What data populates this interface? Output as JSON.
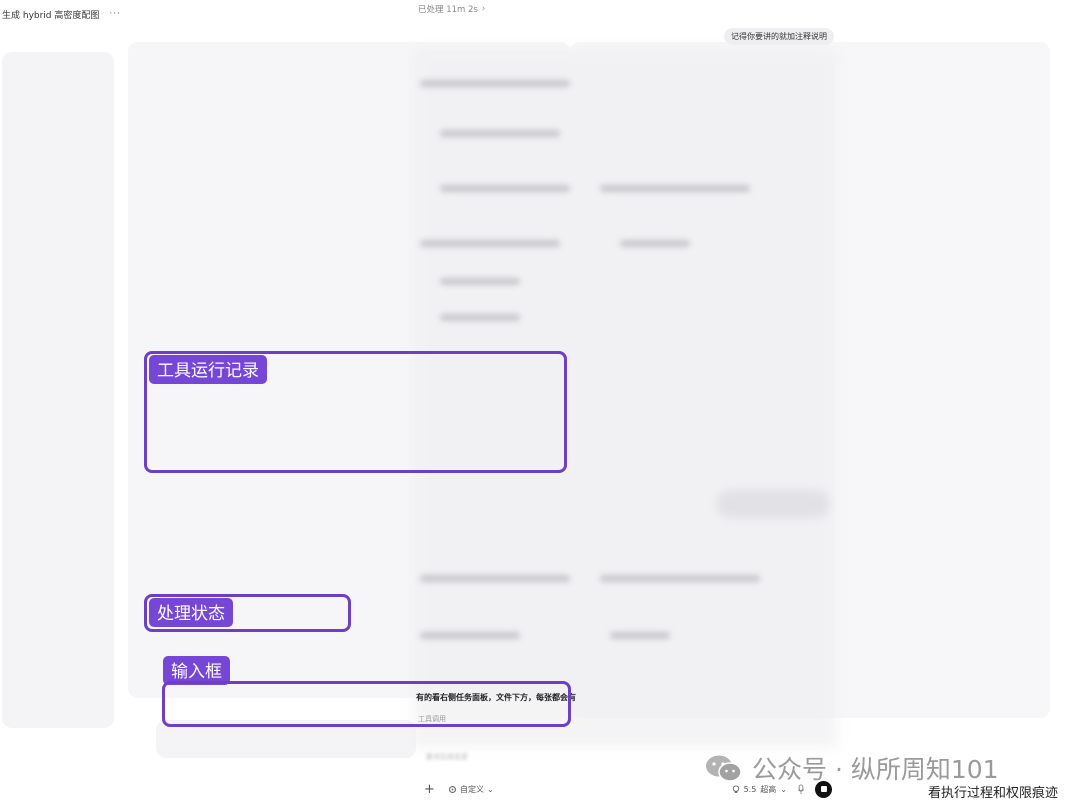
{
  "header": {
    "title": "生成 hybrid 高密度配图",
    "more": "···"
  },
  "status": {
    "text": "已处理 11m 2s",
    "chevron": "›"
  },
  "chat": {
    "user_message": "记得你要讲的就加注释说明"
  },
  "partial_text": {
    "line1": "有的看右侧任务面板，文件下方，每张都会有",
    "line2": "工具调用"
  },
  "composer": {
    "placeholder": "要求后续变更",
    "add_icon": "plus-icon",
    "custom_label": "自定义",
    "model_label": "5.5",
    "quality_label": "超高",
    "mic_icon": "mic-icon",
    "stop_icon": "stop-icon"
  },
  "annotations": {
    "tool_log": "工具运行记录",
    "processing_status": "处理状态",
    "input_box": "输入框",
    "color": "#6d3fc5"
  },
  "watermark": {
    "text": "公众号 · 纵所周知101",
    "icon": "wechat-icon"
  },
  "caption": {
    "text": "看执行过程和权限痕迹"
  }
}
